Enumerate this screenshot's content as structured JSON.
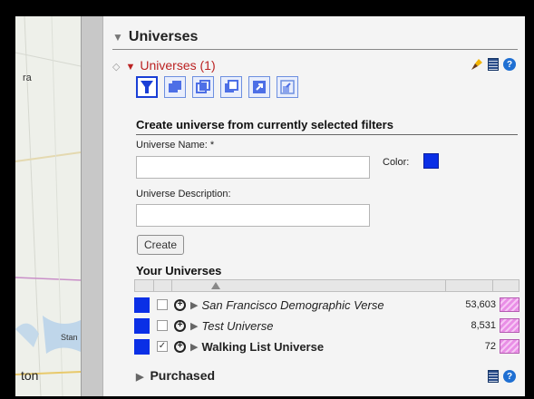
{
  "map": {
    "labels": [
      "ra",
      "Stan",
      "ton"
    ]
  },
  "panel": {
    "title": "Universes",
    "subsection": "Universes (1)",
    "tool_icons": [
      "filter-icon",
      "union-icon",
      "intersect-icon",
      "subtract-icon",
      "export-icon",
      "import-icon"
    ],
    "create": {
      "heading": "Create universe from currently selected filters",
      "name_label": "Universe Name: *",
      "name_value": "",
      "description_label": "Universe Description:",
      "description_value": "",
      "color_label": "Color:",
      "color_value": "#0a2fe6",
      "button": "Create"
    },
    "list": {
      "heading": "Your Universes",
      "rows": [
        {
          "name": "San Francisco Demographic Verse",
          "count": "53,603",
          "checked": false,
          "color": "#0a2fe6"
        },
        {
          "name": "Test Universe",
          "count": "8,531",
          "checked": false,
          "color": "#0a2fe6"
        },
        {
          "name": "Walking List Universe",
          "count": "72",
          "checked": true,
          "color": "#0a2fe6"
        }
      ]
    },
    "purchased": "Purchased",
    "colors": {
      "accent_red": "#b22222",
      "tool_blue": "#4d6fe6"
    }
  }
}
